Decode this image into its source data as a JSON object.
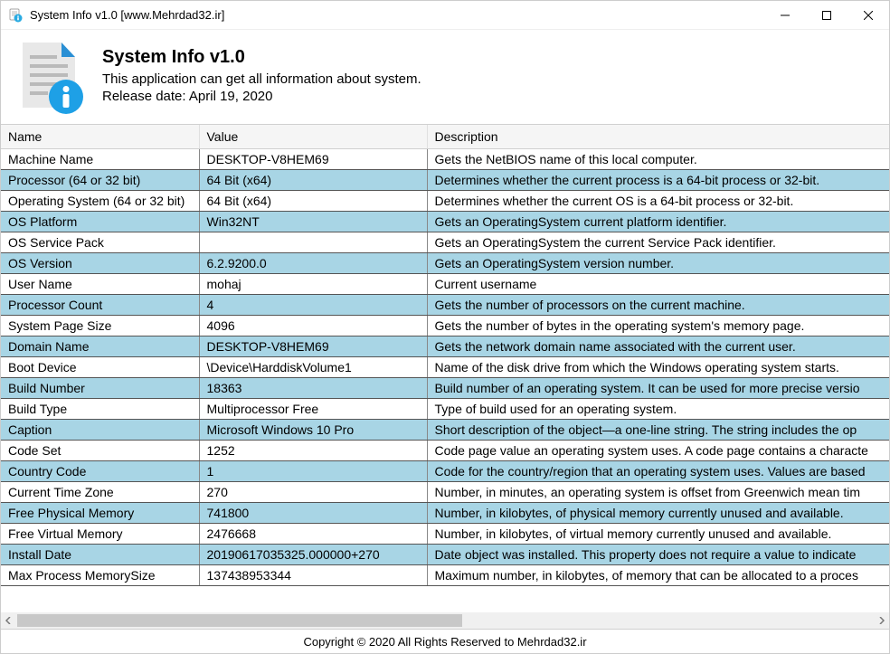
{
  "window": {
    "title": "System Info v1.0 [www.Mehrdad32.ir]"
  },
  "header": {
    "title": "System Info v1.0",
    "subtitle": "This application can get all information about system.",
    "releaseDateLabel": "Release date: April 19, 2020"
  },
  "table": {
    "columns": {
      "name": "Name",
      "value": "Value",
      "description": "Description"
    },
    "rows": [
      {
        "name": "Machine Name",
        "value": "DESKTOP-V8HEM69",
        "description": "Gets the NetBIOS name of this local computer."
      },
      {
        "name": "Processor (64 or 32 bit)",
        "value": "64 Bit (x64)",
        "description": "Determines whether the current process is a 64-bit process or 32-bit."
      },
      {
        "name": "Operating System (64 or 32 bit)",
        "value": "64 Bit (x64)",
        "description": "Determines whether the current OS is a 64-bit process or 32-bit."
      },
      {
        "name": "OS Platform",
        "value": "Win32NT",
        "description": "Gets an OperatingSystem current platform identifier."
      },
      {
        "name": "OS Service Pack",
        "value": "",
        "description": "Gets an OperatingSystem the current Service Pack identifier."
      },
      {
        "name": "OS Version",
        "value": "6.2.9200.0",
        "description": "Gets an OperatingSystem version number."
      },
      {
        "name": "User Name",
        "value": "mohaj",
        "description": "Current username"
      },
      {
        "name": "Processor Count",
        "value": "4",
        "description": "Gets the number of processors on the current machine."
      },
      {
        "name": "System Page Size",
        "value": "4096",
        "description": "Gets the number of bytes in the operating system's memory page."
      },
      {
        "name": "Domain Name",
        "value": "DESKTOP-V8HEM69",
        "description": "Gets the network domain name associated with the current user."
      },
      {
        "name": "Boot Device",
        "value": "\\Device\\HarddiskVolume1",
        "description": "Name of the disk drive from which the Windows operating system starts."
      },
      {
        "name": "Build Number",
        "value": "18363",
        "description": "Build number of an operating system. It can be used for more precise versio"
      },
      {
        "name": "Build Type",
        "value": "Multiprocessor Free",
        "description": "Type of build used for an operating system."
      },
      {
        "name": "Caption",
        "value": "Microsoft Windows 10 Pro",
        "description": "Short description of the object—a one-line string. The string includes the op"
      },
      {
        "name": "Code Set",
        "value": "1252",
        "description": "Code page value an operating system uses. A code page contains a characte"
      },
      {
        "name": "Country Code",
        "value": "1",
        "description": "Code for the country/region that an operating system uses. Values are based"
      },
      {
        "name": "Current Time Zone",
        "value": "270",
        "description": "Number, in minutes, an operating system is offset from Greenwich mean tim"
      },
      {
        "name": "Free Physical Memory",
        "value": "741800",
        "description": "Number, in kilobytes, of physical memory currently unused and available."
      },
      {
        "name": "Free Virtual Memory",
        "value": "2476668",
        "description": "Number, in kilobytes, of virtual memory currently unused and available."
      },
      {
        "name": "Install Date",
        "value": "20190617035325.000000+270",
        "description": "Date object was installed. This property does not require a value to indicate"
      },
      {
        "name": "Max Process MemorySize",
        "value": "137438953344",
        "description": "Maximum number, in kilobytes, of memory that can be allocated to a proces"
      }
    ]
  },
  "footer": {
    "text": "Copyright © 2020 All Rights Reserved to Mehrdad32.ir"
  }
}
